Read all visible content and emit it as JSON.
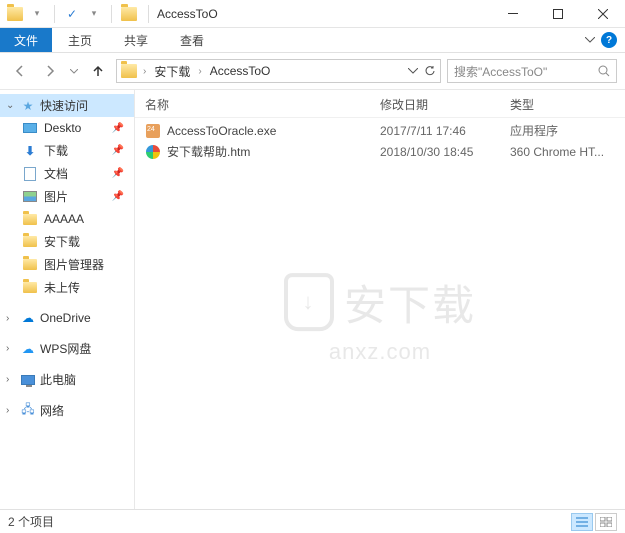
{
  "titlebar": {
    "title": "AccessToO",
    "check_icon": "✓"
  },
  "ribbon": {
    "file": "文件",
    "tabs": [
      "主页",
      "共享",
      "查看"
    ]
  },
  "navbar": {
    "breadcrumbs": [
      "安下载",
      "AccessToO"
    ],
    "search_placeholder": "搜索\"AccessToO\""
  },
  "sidebar": {
    "quick_access": "快速访问",
    "quick_items": [
      {
        "label": "Deskto",
        "pin": true,
        "icon": "desktop"
      },
      {
        "label": "下载",
        "pin": true,
        "icon": "download"
      },
      {
        "label": "文档",
        "pin": true,
        "icon": "doc"
      },
      {
        "label": "图片",
        "pin": true,
        "icon": "pic"
      },
      {
        "label": "AAAAA",
        "pin": false,
        "icon": "folder"
      },
      {
        "label": "安下载",
        "pin": false,
        "icon": "folder"
      },
      {
        "label": "图片管理器",
        "pin": false,
        "icon": "folder"
      },
      {
        "label": "未上传",
        "pin": false,
        "icon": "folder"
      }
    ],
    "onedrive": "OneDrive",
    "wps": "WPS网盘",
    "thispc": "此电脑",
    "network": "网络"
  },
  "columns": {
    "name": "名称",
    "date": "修改日期",
    "type": "类型"
  },
  "files": [
    {
      "name": "AccessToOracle.exe",
      "date": "2017/7/11 17:46",
      "type": "应用程序",
      "icon": "exe"
    },
    {
      "name": "安下载帮助.htm",
      "date": "2018/10/30 18:45",
      "type": "360 Chrome HT...",
      "icon": "htm"
    }
  ],
  "watermark": {
    "text": "安下载",
    "url": "anxz.com"
  },
  "statusbar": {
    "count": "2 个项目"
  }
}
